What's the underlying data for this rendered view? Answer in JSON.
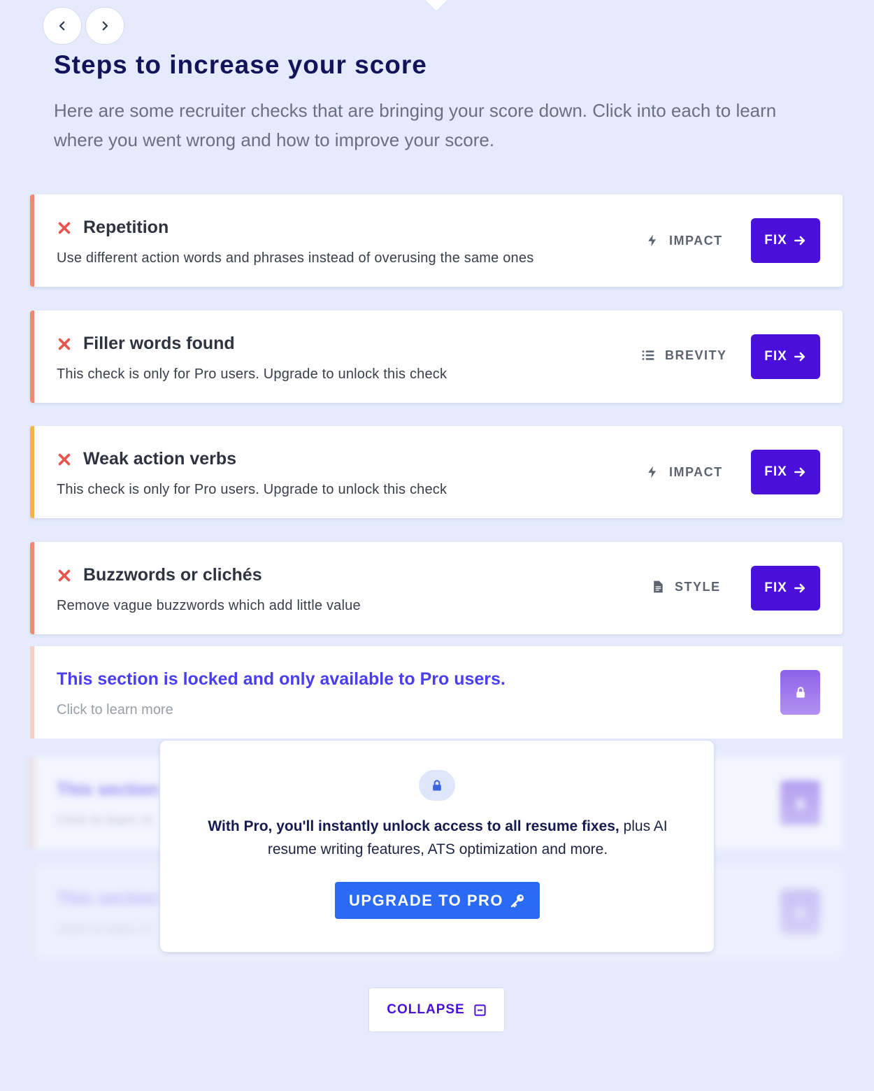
{
  "header": {
    "title": "Steps to increase your score",
    "description": "Here are some recruiter checks that are bringing your score down. Click into each to learn where you went wrong and how to improve your score."
  },
  "checks": [
    {
      "title": "Repetition",
      "description": "Use different action words and phrases instead of overusing the same ones",
      "category": "IMPACT",
      "category_icon": "lightning-icon",
      "accent_color": "#ef8a70",
      "fix_label": "FIX"
    },
    {
      "title": "Filler words found",
      "description": "This check is only for Pro users. Upgrade to unlock this check",
      "category": "BREVITY",
      "category_icon": "list-icon",
      "accent_color": "#ef8a70",
      "fix_label": "FIX"
    },
    {
      "title": "Weak action verbs",
      "description": "This check is only for Pro users. Upgrade to unlock this check",
      "category": "IMPACT",
      "category_icon": "lightning-icon",
      "accent_color": "#f4b34a",
      "fix_label": "FIX"
    },
    {
      "title": "Buzzwords or clichés",
      "description": "Remove vague buzzwords which add little value",
      "category": "STYLE",
      "category_icon": "document-icon",
      "accent_color": "#ef8a70",
      "fix_label": "FIX"
    }
  ],
  "locked_section": {
    "title": "This section is locked and only available to Pro users.",
    "subtitle": "Click to learn more",
    "blurred_title_1": "This section",
    "blurred_sub_1": "Click to learn m",
    "blurred_title_2": "This section",
    "blurred_sub_2": "Click to learn m"
  },
  "upgrade_popup": {
    "text_bold": "With Pro, you'll instantly unlock access to all resume fixes,",
    "text_rest": " plus AI resume writing features, ATS optimization and more.",
    "button_label": "UPGRADE TO PRO"
  },
  "collapse_label": "COLLAPSE",
  "colors": {
    "background": "#e5ebfd",
    "fix_button": "#4a10d9",
    "upgrade_button": "#2b6af5",
    "locked_title": "#4a3ef0",
    "error_x": "#e8544e"
  }
}
